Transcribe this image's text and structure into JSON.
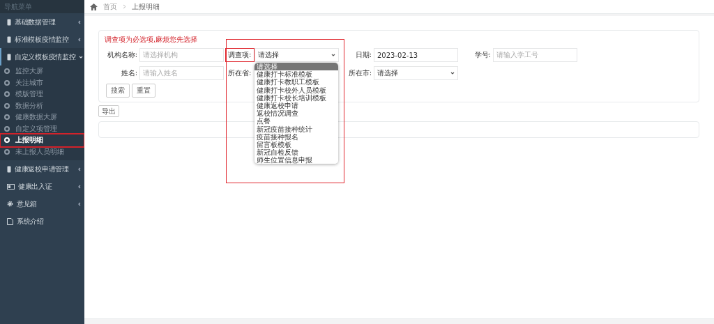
{
  "sidebar": {
    "title": "导航菜单",
    "items": [
      {
        "label": "基础数据管理",
        "expanded": false
      },
      {
        "label": "标准模板疫情监控",
        "expanded": false
      },
      {
        "label": "自定义模板疫情监控",
        "expanded": true,
        "children": [
          {
            "label": "监控大屏",
            "selected": false
          },
          {
            "label": "关注城市",
            "selected": false
          },
          {
            "label": "模版管理",
            "selected": false
          },
          {
            "label": "数据分析",
            "selected": false
          },
          {
            "label": "健康数据大屏",
            "selected": false
          },
          {
            "label": "自定义项管理",
            "selected": false
          },
          {
            "label": "上报明细",
            "selected": true
          },
          {
            "label": "未上报人员明细",
            "selected": false
          }
        ]
      },
      {
        "label": "健康返校申请管理",
        "expanded": false
      },
      {
        "label": "健康出入证",
        "expanded": false
      },
      {
        "label": "意见箱",
        "expanded": false
      },
      {
        "label": "系统介绍"
      }
    ]
  },
  "breadcrumb": [
    "首页",
    "上报明细"
  ],
  "form": {
    "notice": "调查项为必选项,麻烦您先选择",
    "org": {
      "label": "机构名称:",
      "placeholder": "请选择机构"
    },
    "survey": {
      "label": "调查项:",
      "value": "请选择"
    },
    "date": {
      "label": "日期:",
      "value": "2023-02-13"
    },
    "student_no": {
      "label": "学号:",
      "placeholder": "请输入学工号"
    },
    "name": {
      "label": "姓名:",
      "placeholder": "请输入姓名"
    },
    "province": {
      "label": "所在省:"
    },
    "city": {
      "label": "所在市:",
      "value": "请选择"
    },
    "buttons": [
      "搜索",
      "重置"
    ]
  },
  "export_button": "导出",
  "dropdown": {
    "options": [
      {
        "label": "请选择",
        "selected": true
      },
      {
        "label": "健康打卡标准模板",
        "selected": false
      },
      {
        "label": "健康打卡教职工模板",
        "selected": false
      },
      {
        "label": "健康打卡校外人员模板",
        "selected": false
      },
      {
        "label": "健康打卡校长培训模板",
        "selected": false
      },
      {
        "label": "健康返校申请",
        "selected": false
      },
      {
        "label": "返校情况调查",
        "selected": false
      },
      {
        "label": "点餐",
        "selected": false
      },
      {
        "label": "新冠疫苗接种统计",
        "selected": false
      },
      {
        "label": "疫苗接种报名",
        "selected": false
      },
      {
        "label": "留言板模板",
        "selected": false
      },
      {
        "label": "新冠自检反馈",
        "selected": false
      },
      {
        "label": "师生位置信息申报",
        "selected": false
      }
    ]
  }
}
